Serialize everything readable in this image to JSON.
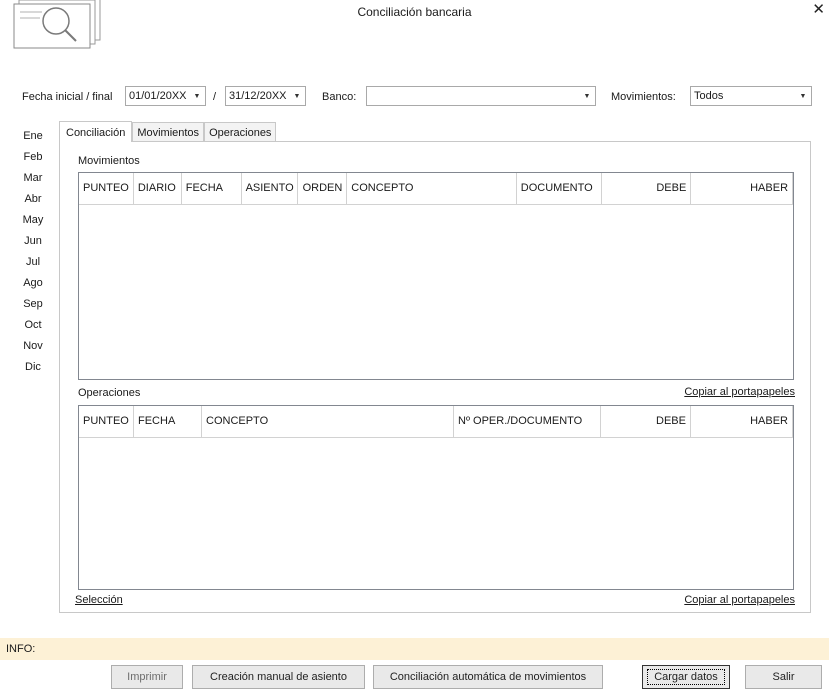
{
  "window": {
    "title": "Conciliación bancaria"
  },
  "filters": {
    "date_label": "Fecha inicial / final",
    "date_start": "01/01/20XX",
    "date_sep": "/",
    "date_end": "31/12/20XX",
    "bank_label": "Banco:",
    "bank_value": "",
    "movements_label": "Movimientos:",
    "movements_value": "Todos"
  },
  "months": [
    "Ene",
    "Feb",
    "Mar",
    "Abr",
    "May",
    "Jun",
    "Jul",
    "Ago",
    "Sep",
    "Oct",
    "Nov",
    "Dic"
  ],
  "tabs": [
    "Conciliación",
    "Movimientos",
    "Operaciones"
  ],
  "movimientos": {
    "label": "Movimientos",
    "columns": [
      "PUNTEO",
      "DIARIO",
      "FECHA",
      "ASIENTO",
      "ORDEN",
      "CONCEPTO",
      "DOCUMENTO",
      "DEBE",
      "HABER"
    ]
  },
  "operaciones": {
    "label": "Operaciones",
    "copy_link": "Copiar al portapapeles",
    "columns": [
      "PUNTEO",
      "FECHA",
      "CONCEPTO",
      "Nº OPER./DOCUMENTO",
      "DEBE",
      "HABER"
    ]
  },
  "bottom_links": {
    "selection": "Selección",
    "copy": "Copiar al portapapeles"
  },
  "info": {
    "label": "INFO:"
  },
  "buttons": {
    "print": "Imprimir",
    "manual_entry": "Creación manual de asiento",
    "auto_reconcile": "Conciliación automática de movimientos",
    "load_data": "Cargar datos",
    "exit": "Salir"
  }
}
